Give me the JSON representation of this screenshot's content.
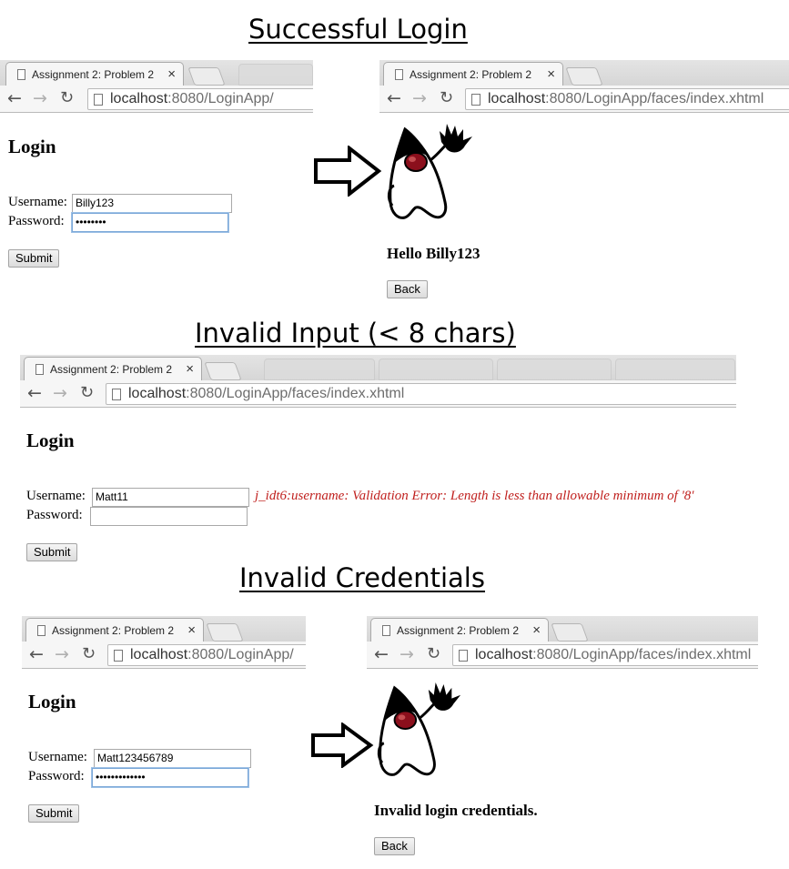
{
  "sections": {
    "successful": {
      "heading": "Successful Login"
    },
    "invalid_input": {
      "heading": "Invalid Input (< 8 chars)"
    },
    "invalid_credentials": {
      "heading": "Invalid Credentials"
    }
  },
  "browser": {
    "tab_title": "Assignment 2: Problem 2",
    "close_glyph": "×",
    "host": "localhost",
    "path_login": ":8080/LoginApp/",
    "path_faces": ":8080/LoginApp/faces/index.xhtml"
  },
  "form": {
    "heading": "Login",
    "username_label": "Username:",
    "password_label": "Password:",
    "submit_label": "Submit"
  },
  "success": {
    "username_value": "Billy123",
    "password_masked": "••••••••",
    "result_message": "Hello Billy123",
    "back_label": "Back"
  },
  "invalid_input": {
    "username_value": "Matt11",
    "password_value": "",
    "error_message": "j_idt6:username: Validation Error: Length is less than allowable minimum of '8'"
  },
  "invalid_credentials": {
    "username_value": "Matt123456789",
    "password_masked": "•••••••••••••",
    "result_message": "Invalid login credentials.",
    "back_label": "Back"
  },
  "icons": [
    "arrow-left-icon",
    "arrow-right-icon",
    "reload-icon",
    "page-icon",
    "close-icon",
    "duke-mascot"
  ]
}
